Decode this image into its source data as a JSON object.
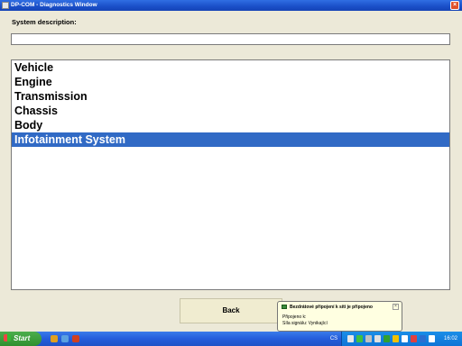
{
  "window": {
    "title": "DP-COM - Diagnostics Window",
    "close_glyph": "×"
  },
  "form": {
    "description_label": "System description:",
    "description_value": ""
  },
  "systems": [
    {
      "label": "Vehicle",
      "selected": false
    },
    {
      "label": "Engine",
      "selected": false
    },
    {
      "label": "Transmission",
      "selected": false
    },
    {
      "label": "Chassis",
      "selected": false
    },
    {
      "label": "Body",
      "selected": false
    },
    {
      "label": "Infotainment System",
      "selected": true
    }
  ],
  "buttons": {
    "back": "Back"
  },
  "notification": {
    "icon": "wireless-network-icon",
    "title": "Bezdrátové připojení k síti je připojeno",
    "line1": "Připojeno k:",
    "line2": "Síla signálu: Vynikající",
    "close_glyph": "×"
  },
  "taskbar": {
    "start_label": "Start",
    "language": "CS",
    "clock": "16:02"
  },
  "colors": {
    "selection": "#316ac5",
    "titlebar": "#1f55d0",
    "taskbar": "#245ddb",
    "start": "#3a9e3a"
  }
}
